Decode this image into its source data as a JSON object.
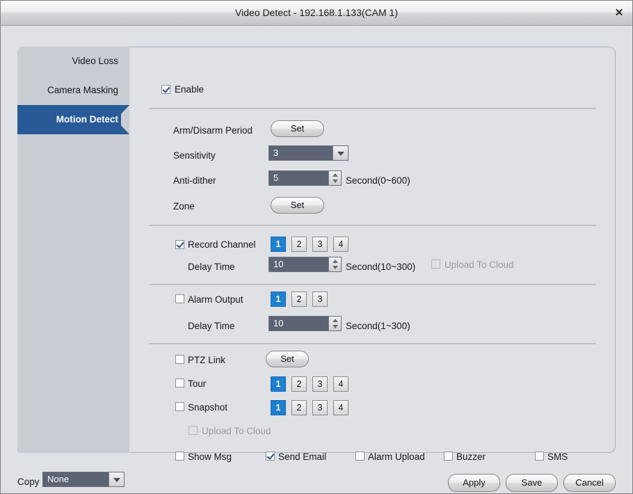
{
  "window": {
    "title": "Video Detect - 192.168.1.133(CAM 1)",
    "close_label": "✕"
  },
  "colors": {
    "accent_blue": "#1f7fd0",
    "sidebar_selected": "#275a96",
    "field_bg": "#5c6372",
    "panel_bg": "#dfe1e5"
  },
  "sidebar": {
    "items": [
      {
        "label": "Video Loss",
        "selected": false
      },
      {
        "label": "Camera Masking",
        "selected": false
      },
      {
        "label": "Motion Detect",
        "selected": true
      }
    ]
  },
  "main": {
    "enable": {
      "label": "Enable",
      "checked": true
    },
    "arm_disarm": {
      "label": "Arm/Disarm Period",
      "button": "Set"
    },
    "sensitivity": {
      "label": "Sensitivity",
      "value": "3"
    },
    "anti_dither": {
      "label": "Anti-dither",
      "value": "5",
      "unit": "Second(0~600)"
    },
    "zone": {
      "label": "Zone",
      "button": "Set"
    },
    "record_channel": {
      "label": "Record Channel",
      "checked": true,
      "channels": [
        "1",
        "2",
        "3",
        "4"
      ],
      "selected_channels": [
        "1"
      ],
      "delay_label": "Delay Time",
      "delay_value": "10",
      "delay_unit": "Second(10~300)",
      "upload_cloud": {
        "label": "Upload To Cloud",
        "checked": false,
        "disabled": true
      }
    },
    "alarm_output": {
      "label": "Alarm Output",
      "checked": false,
      "channels": [
        "1",
        "2",
        "3"
      ],
      "selected_channels": [
        "1"
      ],
      "delay_label": "Delay Time",
      "delay_value": "10",
      "delay_unit": "Second(1~300)"
    },
    "ptz_link": {
      "label": "PTZ Link",
      "checked": false,
      "button": "Set"
    },
    "tour": {
      "label": "Tour",
      "checked": false,
      "channels": [
        "1",
        "2",
        "3",
        "4"
      ],
      "selected_channels": [
        "1"
      ]
    },
    "snapshot": {
      "label": "Snapshot",
      "checked": false,
      "channels": [
        "1",
        "2",
        "3",
        "4"
      ],
      "selected_channels": [
        "1"
      ]
    },
    "snapshot_upload_cloud": {
      "label": "Upload To Cloud",
      "checked": false,
      "disabled": true
    },
    "notifications": [
      {
        "label": "Show Msg",
        "checked": false
      },
      {
        "label": "Send Email",
        "checked": true
      },
      {
        "label": "Alarm Upload",
        "checked": false
      },
      {
        "label": "Buzzer",
        "checked": false
      },
      {
        "label": "SMS",
        "checked": false
      }
    ]
  },
  "footer": {
    "copy_label": "Copy",
    "copy_value": "None",
    "apply": "Apply",
    "save": "Save",
    "cancel": "Cancel"
  }
}
